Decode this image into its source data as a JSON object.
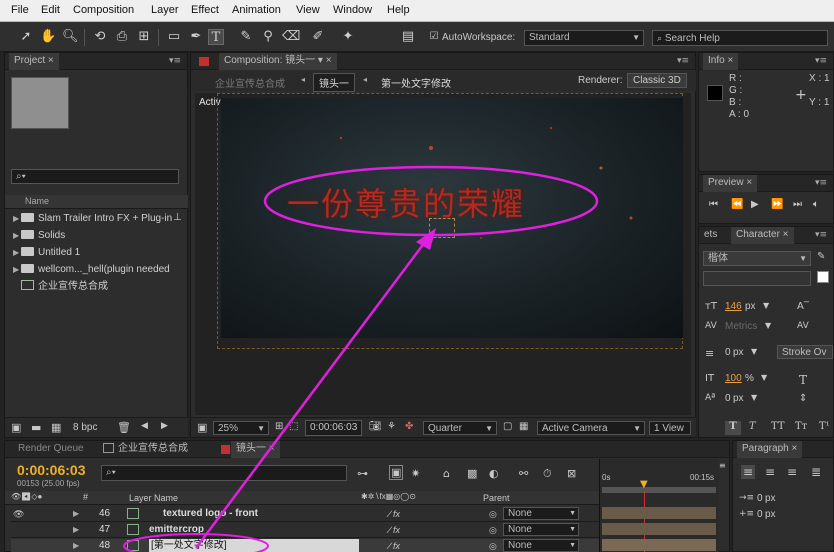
{
  "menu": [
    "File",
    "Edit",
    "Composition",
    "Layer",
    "Effect",
    "Animation",
    "View",
    "Window",
    "Help"
  ],
  "toolbar": {
    "autoworkspace_label": "AutoWorkspace:",
    "workspace_value": "Standard",
    "search_placeholder": "Search Help"
  },
  "project": {
    "tab": "Project",
    "column_name": "Name",
    "items": [
      {
        "label": "Slam Trailer Intro FX + Plug-in",
        "type": "folder"
      },
      {
        "label": "Solids",
        "type": "folder"
      },
      {
        "label": "Untitled 1",
        "type": "folder"
      },
      {
        "label": "wellcom..._hell(plugin needed",
        "type": "folder"
      },
      {
        "label": "企业宣传总合成",
        "type": "comp"
      }
    ],
    "bpc": "8 bpc"
  },
  "composition": {
    "tab": "Composition: 镜头一",
    "breadcrumb_prev": "企业宣传总合成",
    "breadcrumb_current": "镜头一",
    "breadcrumb_next": "第一处文字修改",
    "renderer_label": "Renderer:",
    "renderer_value": "Classic 3D",
    "camera_label": "Active Camera",
    "title_text": "一份尊贵的荣耀",
    "zoom": "25%",
    "timecode": "0:00:06:03",
    "resolution": "Quarter",
    "view_camera": "Active Camera",
    "view_count": "1 View"
  },
  "info": {
    "tab": "Info",
    "r": "R :",
    "g": "G :",
    "b": "B :",
    "a": "A :  0",
    "x": "X : 1",
    "y": "Y : 1"
  },
  "preview": {
    "tab": "Preview"
  },
  "character": {
    "tab_effects": "ets",
    "tab": "Character",
    "font": "楷体",
    "size": "146",
    "size_unit": "px",
    "metrics": "Metrics",
    "stroke_width": "0",
    "stroke_unit": "px",
    "stroke_type": "Stroke Ov",
    "vscale": "100",
    "vscale_unit": "%",
    "baseline": "0",
    "baseline_unit": "px"
  },
  "paragraph": {
    "tab": "Paragraph",
    "indent1": "0",
    "indent2": "0",
    "unit": "px"
  },
  "timeline": {
    "tab_render": "Render Queue",
    "tab_comp1": "企业宣传总合成",
    "tab_comp2": "镜头一",
    "timecode": "0:00:06:03",
    "fps": "00153 (25.00 fps)",
    "col_layer_name": "Layer Name",
    "col_parent": "Parent",
    "ruler_start": "0s",
    "ruler_end": "00:15s",
    "layers": [
      {
        "num": "46",
        "name": "textured logo - front",
        "parent": "None"
      },
      {
        "num": "47",
        "name": "emittercrop",
        "parent": "None"
      },
      {
        "num": "48",
        "name": "[第一处文字修改]",
        "parent": "None"
      }
    ]
  },
  "colors": {
    "annotation": "#e020e0",
    "title_red": "#b8281e",
    "timecode": "#f0b020"
  }
}
